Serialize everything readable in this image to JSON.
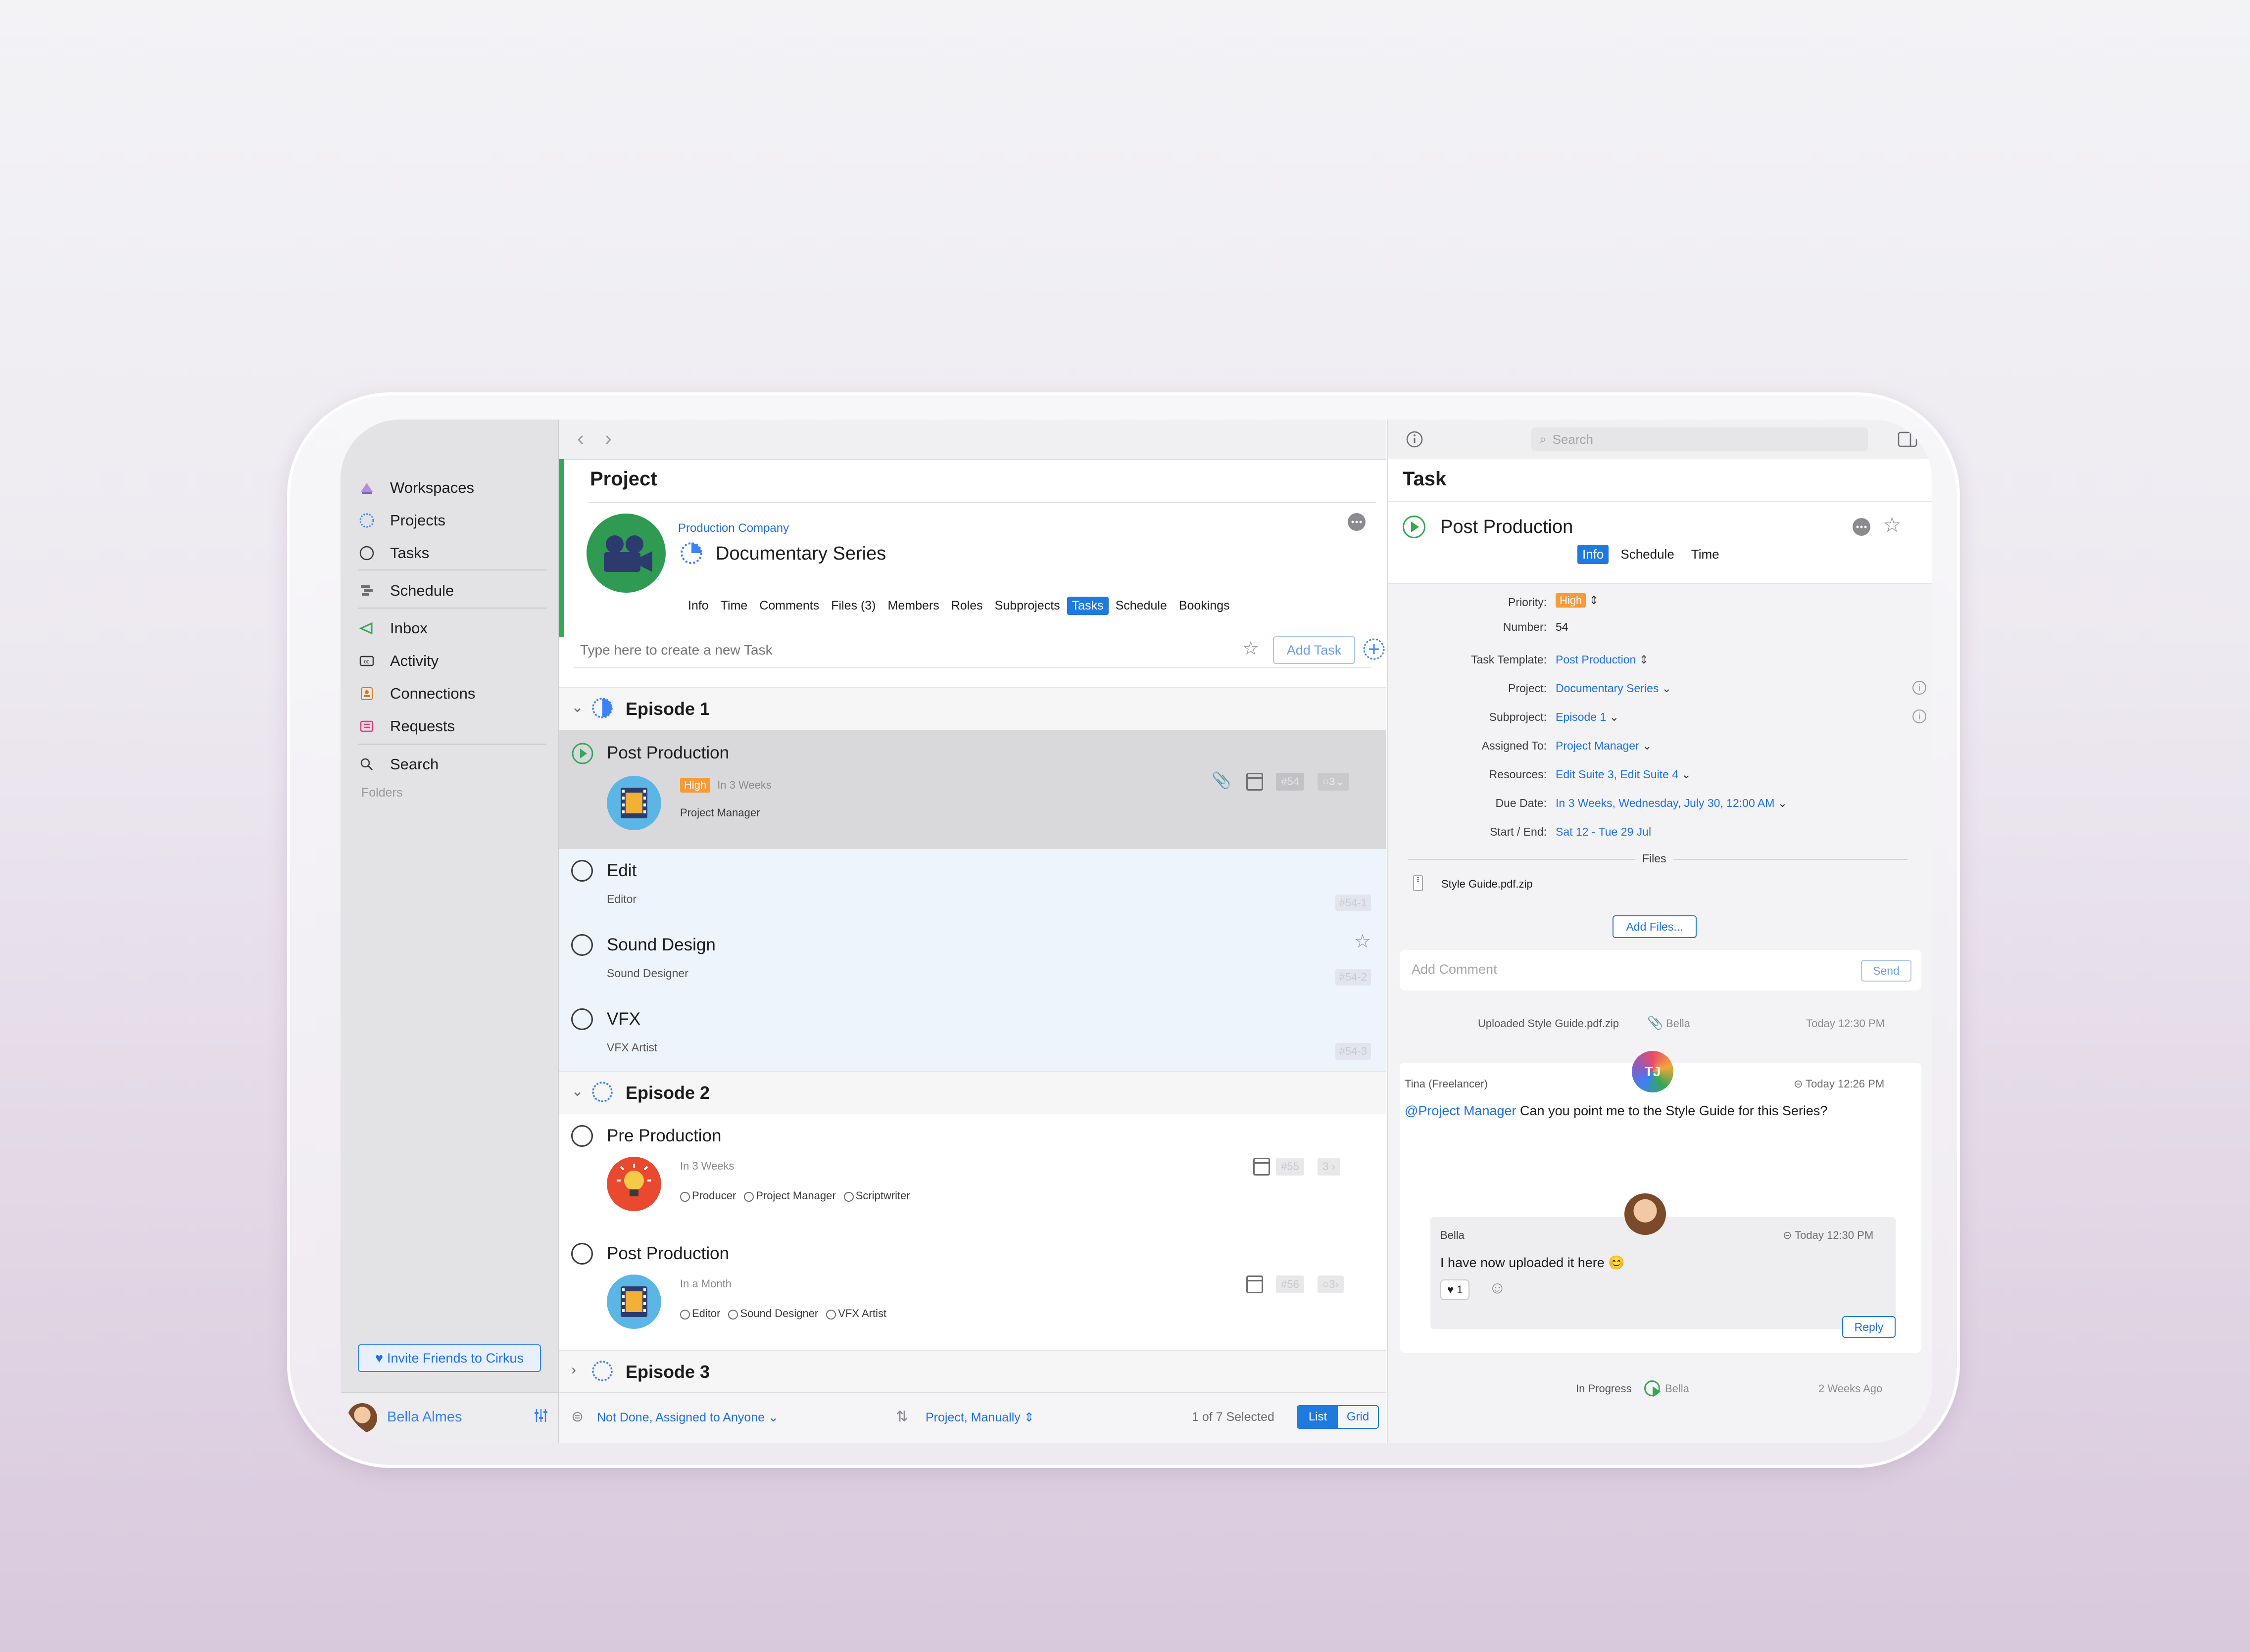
{
  "sidebar": {
    "items": [
      {
        "label": "Workspaces",
        "icon": "workspaces-icon"
      },
      {
        "label": "Projects",
        "icon": "projects-icon"
      },
      {
        "label": "Tasks",
        "icon": "tasks-icon"
      },
      {
        "label": "Schedule",
        "icon": "schedule-icon"
      },
      {
        "label": "Inbox",
        "icon": "inbox-icon"
      },
      {
        "label": "Activity",
        "icon": "activity-icon"
      },
      {
        "label": "Connections",
        "icon": "connections-icon"
      },
      {
        "label": "Requests",
        "icon": "requests-icon"
      },
      {
        "label": "Search",
        "icon": "search-icon"
      }
    ],
    "folders_label": "Folders",
    "invite_label": "Invite Friends to Cirkus",
    "user_name": "Bella Almes"
  },
  "project": {
    "section_title": "Project",
    "company": "Production Company",
    "name": "Documentary Series",
    "tabs": [
      "Info",
      "Time",
      "Comments",
      "Files (3)",
      "Members",
      "Roles",
      "Subprojects",
      "Tasks",
      "Schedule",
      "Bookings"
    ],
    "active_tab": "Tasks",
    "new_task_placeholder": "Type here to create a new Task",
    "add_task_label": "Add Task"
  },
  "groups": [
    {
      "title": "Episode 1"
    },
    {
      "title": "Episode 2"
    },
    {
      "title": "Episode 3"
    }
  ],
  "tasks": {
    "ep1_post": {
      "title": "Post Production",
      "priority": "High",
      "due": "In 3 Weeks",
      "role": "Project Manager",
      "number": "#54",
      "subtasks": "3"
    },
    "edit": {
      "title": "Edit",
      "role": "Editor",
      "number": "#54-1"
    },
    "sound": {
      "title": "Sound Design",
      "role": "Sound Designer",
      "number": "#54-2"
    },
    "vfx": {
      "title": "VFX",
      "role": "VFX Artist",
      "number": "#54-3"
    },
    "pre": {
      "title": "Pre Production",
      "due": "In 3 Weeks",
      "resources": [
        "Producer",
        "Project Manager",
        "Scriptwriter"
      ],
      "number": "#55",
      "subtasks": "3"
    },
    "ep2_post": {
      "title": "Post Production",
      "due": "In a Month",
      "resources": [
        "Editor",
        "Sound Designer",
        "VFX Artist"
      ],
      "number": "#56",
      "subtasks": "3"
    }
  },
  "bottom_bar": {
    "filter": "Not Done, Assigned to Anyone",
    "sort": "Project, Manually",
    "selection": "1 of 7 Selected",
    "view_list": "List",
    "view_grid": "Grid"
  },
  "right": {
    "search_placeholder": "Search",
    "section_title": "Task",
    "task_title": "Post Production",
    "tabs": [
      "Info",
      "Schedule",
      "Time"
    ],
    "active_tab": "Info",
    "fields": {
      "priority_label": "Priority:",
      "priority": "High",
      "number_label": "Number:",
      "number": "54",
      "template_label": "Task Template:",
      "template": "Post Production",
      "project_label": "Project:",
      "project": "Documentary Series",
      "subproject_label": "Subproject:",
      "subproject": "Episode 1",
      "assigned_label": "Assigned To:",
      "assigned": "Project Manager",
      "resources_label": "Resources:",
      "resources": "Edit Suite 3, Edit Suite 4",
      "due_label": "Due Date:",
      "due": "In 3 Weeks, Wednesday, July 30, 12:00 AM",
      "startend_label": "Start / End:",
      "startend": "Sat 12 - Tue 29 Jul"
    },
    "files_label": "Files",
    "file_name": "Style Guide.pdf.zip",
    "add_files_label": "Add Files...",
    "comment_placeholder": "Add Comment",
    "send_label": "Send",
    "activity": [
      {
        "text": "Uploaded Style Guide.pdf.zip",
        "user": "Bella",
        "time": "Today 12:30 PM"
      }
    ],
    "comment1": {
      "author": "Tina (Freelancer)",
      "initials": "TJ",
      "time": "Today 12:26 PM",
      "mention": "@Project Manager",
      "text": "Can you point me to the Style Guide for this Series?"
    },
    "comment2": {
      "author": "Bella",
      "time": "Today 12:30 PM",
      "text": "I have now uploaded it here 😊",
      "reaction": "♥ 1"
    },
    "reply_label": "Reply",
    "status": {
      "text": "In Progress",
      "user": "Bella",
      "time": "2 Weeks Ago"
    }
  }
}
